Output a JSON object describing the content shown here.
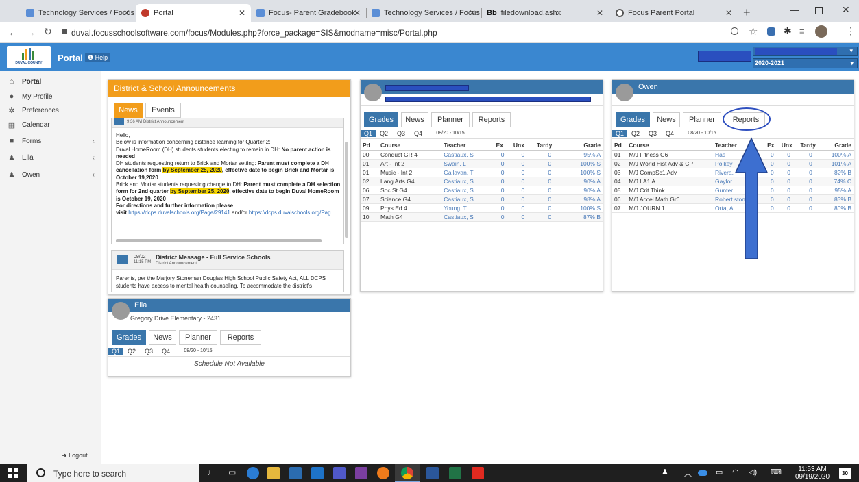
{
  "browser": {
    "tabs": [
      {
        "title": "Technology Services / Focus"
      },
      {
        "title": "Portal"
      },
      {
        "title": "Focus- Parent Gradebook"
      },
      {
        "title": "Technology Services / Focus"
      },
      {
        "title": "filedownload.ashx"
      },
      {
        "title": "Focus Parent Portal"
      }
    ],
    "new_tab": "+",
    "url": "duval.focusschoolsoftware.com/focus/Modules.php?force_package=SIS&modname=misc/Portal.php"
  },
  "header": {
    "logo_text": "DUVAL COUNTY",
    "portal_label": "Portal",
    "help_label": "Help",
    "year_select": "2020-2021"
  },
  "sidebar": {
    "items": [
      {
        "label": "Portal",
        "icon": "home-icon"
      },
      {
        "label": "My Profile",
        "icon": "user-icon"
      },
      {
        "label": "Preferences",
        "icon": "gear-icon"
      },
      {
        "label": "Calendar",
        "icon": "calendar-icon"
      },
      {
        "label": "Forms",
        "icon": "folder-icon"
      },
      {
        "label": "Ella",
        "icon": "person-icon"
      },
      {
        "label": "Owen",
        "icon": "person-icon"
      }
    ],
    "logout": "Logout"
  },
  "announcements": {
    "title": "District & School Announcements",
    "tabs": [
      "News",
      "Events"
    ],
    "item1": {
      "time": "9:36 AM",
      "category": "District Announcement",
      "p1": "Hello,",
      "p2": "Below is information concerning distance learning for Quarter 2:",
      "p3a": "Duval HomeRoom (DH) students students electing to remain in DH: ",
      "p3b": "No parent action is needed",
      "p4a": "DH students requesting return to Brick and Mortar setting: ",
      "p4b": "Parent must complete a DH cancellation form ",
      "p4c": "by September 25, 2020",
      "p4d": ", effective date to begin Brick and Mortar is October 19,2020",
      "p5a": "Brick and Mortar students requesting change to DH: ",
      "p5b": "Parent must complete a DH selection form for 2nd quarter ",
      "p5c": "by September 25, 2020",
      "p5d": ", effective date to begin Duval HomeRoom is October 19, 2020",
      "p6": "For directions and further information please",
      "p7a": "visit ",
      "p7b": "https://dcps.duvalschools.org/Page/29141",
      "p7c": " and/or ",
      "p7d": "https://dcps.duvalschools.org/Pag"
    },
    "item2": {
      "date": "09/02",
      "time": "11:15 PM",
      "title": "District Message - Full Service Schools",
      "category": "District Announcement",
      "body1": "Parents, per the Marjory Stoneman Douglas High School Public Safety Act, ALL DCPS",
      "body2": "students have access to mental health counseling. To accommodate the district's"
    }
  },
  "student_tabs": [
    "Grades",
    "News",
    "Planner",
    "Reports"
  ],
  "quarters": [
    "Q1",
    "Q2",
    "Q3",
    "Q4"
  ],
  "date_range": "08/20 - 10/15",
  "columns": [
    "Pd",
    "Course",
    "Teacher",
    "Ex",
    "Unx",
    "Tardy",
    "Grade"
  ],
  "student1": {
    "rows": [
      [
        "00",
        "Conduct GR 4",
        "Castiaux, S",
        "0",
        "0",
        "0",
        "95% A"
      ],
      [
        "01",
        "Art - Int 2",
        "Swain, L",
        "0",
        "0",
        "0",
        "100% S"
      ],
      [
        "01",
        "Music - Int 2",
        "Gallavan, T",
        "0",
        "0",
        "0",
        "100% S"
      ],
      [
        "02",
        "Lang Arts G4",
        "Castiaux, S",
        "0",
        "0",
        "0",
        "90% A"
      ],
      [
        "06",
        "Soc St G4",
        "Castiaux, S",
        "0",
        "0",
        "0",
        "90% A"
      ],
      [
        "07",
        "Science G4",
        "Castiaux, S",
        "0",
        "0",
        "0",
        "98% A"
      ],
      [
        "09",
        "Phys Ed 4",
        "Young, T",
        "0",
        "0",
        "0",
        "100% S"
      ],
      [
        "10",
        "Math G4",
        "Castiaux, S",
        "0",
        "0",
        "0",
        "87% B"
      ]
    ]
  },
  "owen": {
    "name": "Owen",
    "rows": [
      [
        "01",
        "M/J Fitness G6",
        "Has",
        "0",
        "0",
        "0",
        "100% A"
      ],
      [
        "02",
        "M/J World Hist Adv & CP",
        "Polkey",
        "0",
        "0",
        "0",
        "101% A"
      ],
      [
        "03",
        "M/J CompSc1 Adv",
        "Rivera,",
        "0",
        "0",
        "0",
        "82% B"
      ],
      [
        "04",
        "M/J LA1 A",
        "Gaylor",
        "0",
        "0",
        "0",
        "74% C"
      ],
      [
        "05",
        "M/J Crit Think",
        "Gunter",
        "0",
        "0",
        "0",
        "95% A"
      ],
      [
        "06",
        "M/J Accel Math Gr6",
        "Robert     ston, K",
        "0",
        "0",
        "0",
        "83% B"
      ],
      [
        "07",
        "M/J JOURN 1",
        "Orta, A",
        "0",
        "0",
        "0",
        "80% B"
      ]
    ]
  },
  "ella": {
    "name": "Ella",
    "school": "Gregory Drive Elementary - 2431",
    "schedule_msg": "Schedule Not Available"
  },
  "taskbar": {
    "search_placeholder": "Type here to search",
    "time": "11:53 AM",
    "date": "09/19/2020",
    "notif_count": "30"
  },
  "colors": {
    "header_blue": "#3a87d0",
    "panel_blue": "#3a76ab",
    "orange": "#f29d1b",
    "highlight": "#f5d400",
    "arrow": "#3d6fd0"
  }
}
